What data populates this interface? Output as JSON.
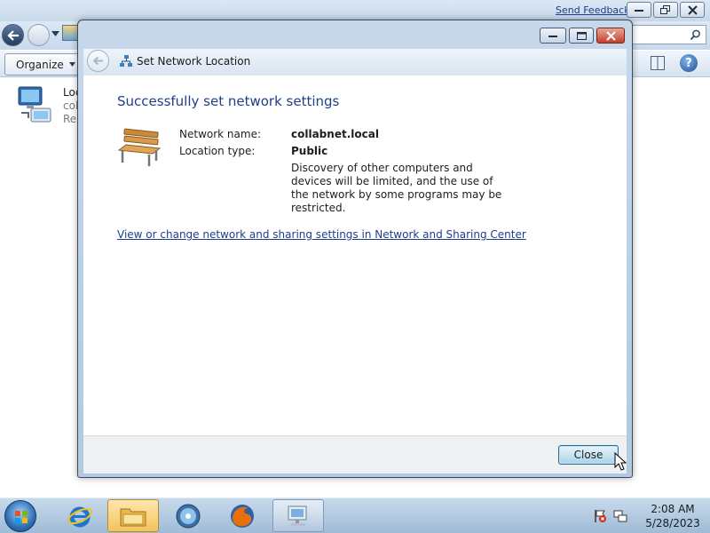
{
  "background_window": {
    "send_feedback_label": "Send Feedback",
    "organize_label": "Organize",
    "item_lines": [
      "Loc",
      "col",
      "Re"
    ]
  },
  "dialog": {
    "title": "Set Network Location",
    "heading": "Successfully set network settings",
    "network_name_label": "Network name:",
    "network_name_value": "collabnet.local",
    "location_type_label": "Location type:",
    "location_type_value": "Public",
    "description": "Discovery of other computers and devices will be limited, and the use of the network by some programs may be restricted.",
    "link_text": "View or change network and sharing settings in Network and Sharing Center",
    "close_label": "Close"
  },
  "taskbar": {
    "items": [
      "start-button",
      "internet-explorer",
      "windows-explorer",
      "windows-media-player",
      "firefox",
      "network-sharing"
    ],
    "time": "2:08 AM",
    "date": "5/28/2023"
  },
  "colors": {
    "heading_blue": "#1f3e8a",
    "title_bar": "#c7d8ea",
    "close_red": "#c4402f"
  }
}
